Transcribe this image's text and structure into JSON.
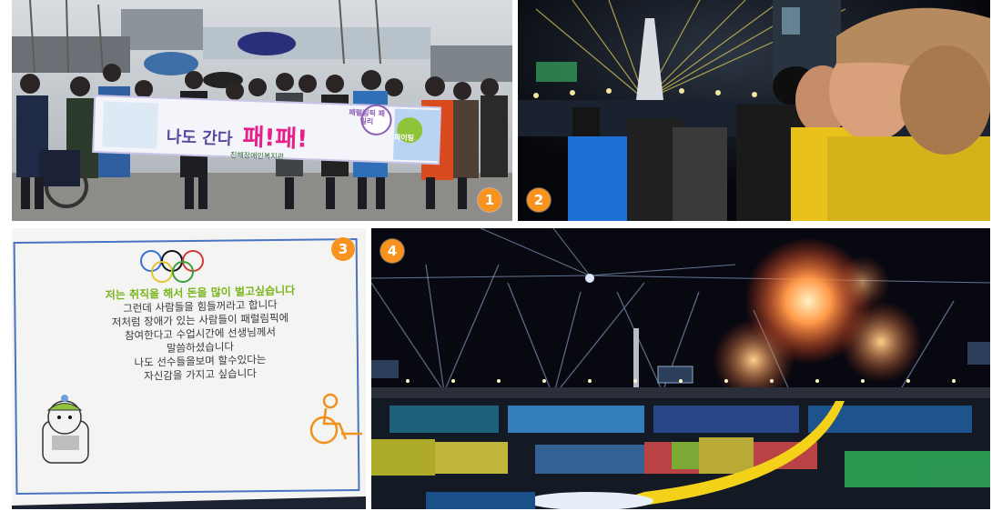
{
  "collage": {
    "panels": [
      {
        "number": "1"
      },
      {
        "number": "2"
      },
      {
        "number": "3"
      },
      {
        "number": "4"
      }
    ],
    "banner": {
      "main_text": "나도 간다",
      "highlight_text": "패!패!",
      "sticker_1": "패럴림픽 패밀리",
      "sticker_2": "파이팅",
      "org_name": "진해장애인복지관"
    },
    "letter": {
      "lines": [
        "저는 취직을 해서 돈을 많이 벌고싶습니다",
        "그런데 사람들을 힘들꺼라고 합니다",
        "저처럼 장애가 있는 사람들이 패럴림픽에",
        "참여한다고 수업시간에 선생님께서",
        "말씀하셨습니다",
        "나도 선수들을보며 할수있다는",
        "자신감을 가지고 싶습니다"
      ]
    },
    "colors": {
      "badge": "#f7931e",
      "letter_highlight": "#7ab51d",
      "firework": "#ff7a3a",
      "yellow_jacket": "#e8c21b"
    }
  }
}
